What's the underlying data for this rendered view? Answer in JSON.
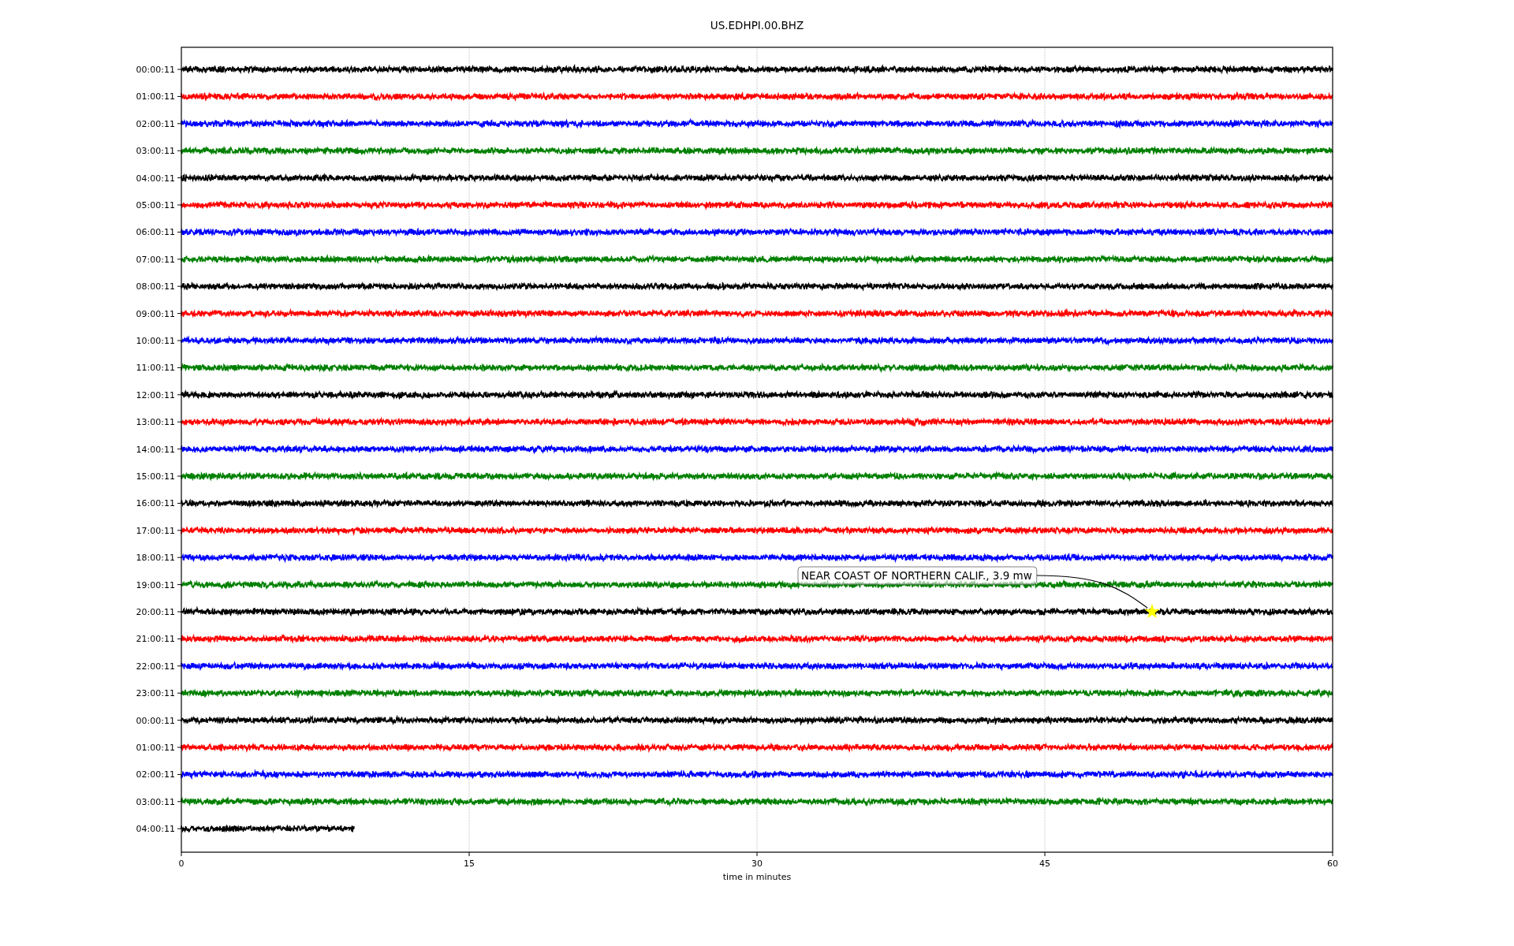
{
  "chart": {
    "title": "US.EDHPI.00.BHZ",
    "xlabel": "time in minutes",
    "xticks": [
      "0",
      "15",
      "30",
      "45",
      "60"
    ],
    "rows": [
      {
        "label": "00:00:11",
        "color": "#000000",
        "level": 1
      },
      {
        "label": "01:00:11",
        "color": "#ff0000",
        "level": 1
      },
      {
        "label": "02:00:11",
        "color": "#0000ff",
        "level": 1
      },
      {
        "label": "03:00:11",
        "color": "#008000",
        "level": 1
      },
      {
        "label": "04:00:11",
        "color": "#000000",
        "level": 1
      },
      {
        "label": "05:00:11",
        "color": "#ff0000",
        "level": 1
      },
      {
        "label": "06:00:11",
        "color": "#0000ff",
        "level": 1
      },
      {
        "label": "07:00:11",
        "color": "#008000",
        "level": 1
      },
      {
        "label": "08:00:11",
        "color": "#000000",
        "level": 1
      },
      {
        "label": "09:00:11",
        "color": "#ff0000",
        "level": 1
      },
      {
        "label": "10:00:11",
        "color": "#0000ff",
        "level": 1
      },
      {
        "label": "11:00:11",
        "color": "#008000",
        "level": 1
      },
      {
        "label": "12:00:11",
        "color": "#000000",
        "level": 1
      },
      {
        "label": "13:00:11",
        "color": "#ff0000",
        "level": 1
      },
      {
        "label": "14:00:11",
        "color": "#0000ff",
        "level": 1
      },
      {
        "label": "15:00:11",
        "color": "#008000",
        "level": 1
      },
      {
        "label": "16:00:11",
        "color": "#000000",
        "level": 1
      },
      {
        "label": "17:00:11",
        "color": "#ff0000",
        "level": 1
      },
      {
        "label": "18:00:11",
        "color": "#0000ff",
        "level": 1
      },
      {
        "label": "19:00:11",
        "color": "#008000",
        "level": 1
      },
      {
        "label": "20:00:11",
        "color": "#000000",
        "level": 1
      },
      {
        "label": "21:00:11",
        "color": "#ff0000",
        "level": 1
      },
      {
        "label": "22:00:11",
        "color": "#0000ff",
        "level": 1
      },
      {
        "label": "23:00:11",
        "color": "#008000",
        "level": 1
      },
      {
        "label": "00:00:11",
        "color": "#000000",
        "level": 1
      },
      {
        "label": "01:00:11",
        "color": "#ff0000",
        "level": 1
      },
      {
        "label": "02:00:11",
        "color": "#0000ff",
        "level": 1
      },
      {
        "label": "03:00:11",
        "color": "#008000",
        "level": 1
      },
      {
        "label": "04:00:11",
        "color": "#000000",
        "level": 0.15
      }
    ],
    "annotation": {
      "text": "NEAR COAST OF NORTHERN CALIF., 3.9 mw"
    }
  }
}
